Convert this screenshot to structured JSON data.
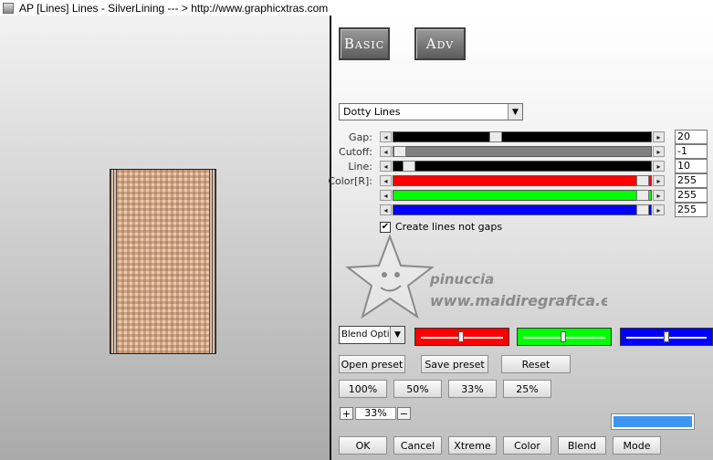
{
  "window": {
    "title": "AP [Lines]  Lines - SilverLining      --- > http://www.graphicxtras.com"
  },
  "tabs": {
    "basic": "Basic",
    "adv": "Adv"
  },
  "preset": {
    "selected": "Dotty Lines"
  },
  "sliders": {
    "gap": {
      "label": "Gap:",
      "value": "20"
    },
    "cutoff": {
      "label": "Cutoff:",
      "value": "-1"
    },
    "line": {
      "label": "Line:",
      "value": "10"
    },
    "color_r": {
      "label": "Color[R]:",
      "value": "255"
    },
    "color_g": {
      "value": "255"
    },
    "color_b": {
      "value": "255"
    }
  },
  "checkbox": {
    "label": "Create lines not gaps",
    "checked": true
  },
  "watermark": {
    "line1": "pinuccia",
    "line2": "www.maidiregrafica.eu"
  },
  "blend": {
    "selected": "Blend Opti"
  },
  "color_sliders": {
    "red": "#ff0000",
    "green": "#00ff00",
    "blue": "#0000ff"
  },
  "buttons": {
    "open_preset": "Open preset",
    "save_preset": "Save preset",
    "reset": "Reset",
    "z100": "100%",
    "z50": "50%",
    "z33": "33%",
    "z25": "25%",
    "plus": "+",
    "minus": "−",
    "ok": "OK",
    "cancel": "Cancel",
    "xtreme": "Xtreme",
    "color": "Color",
    "blend": "Blend",
    "mode": "Mode"
  },
  "zoom": {
    "value": "33%"
  },
  "swatch_color": "#3c96f0"
}
